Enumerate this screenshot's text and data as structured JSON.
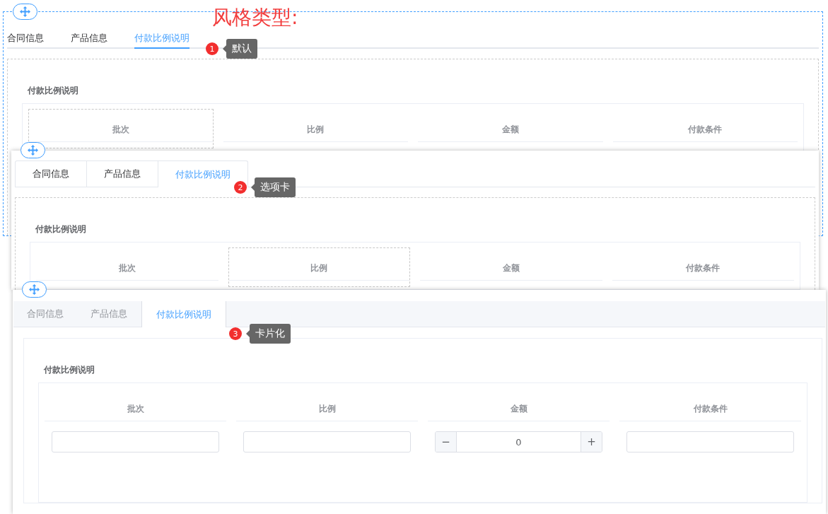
{
  "heading": "风格类型:",
  "panels": [
    {
      "kind": "default",
      "selected": true,
      "badge": "1",
      "label": "默认",
      "tabs": [
        {
          "label": "合同信息",
          "selected": false
        },
        {
          "label": "产品信息",
          "selected": false
        },
        {
          "label": "付款比例说明",
          "selected": true
        }
      ],
      "section_title": "付款比例说明",
      "columns": [
        {
          "header": "批次",
          "selected": true
        },
        {
          "header": "比例",
          "selected": false
        },
        {
          "header": "金额",
          "selected": false
        },
        {
          "header": "付款条件",
          "selected": false
        }
      ]
    },
    {
      "kind": "tabs",
      "selected": false,
      "badge": "2",
      "label": "选项卡",
      "tabs": [
        {
          "label": "合同信息",
          "selected": false
        },
        {
          "label": "产品信息",
          "selected": false
        },
        {
          "label": "付款比例说明",
          "selected": true
        }
      ],
      "section_title": "付款比例说明",
      "columns": [
        {
          "header": "批次",
          "selected": false
        },
        {
          "header": "比例",
          "selected": true
        },
        {
          "header": "金额",
          "selected": false
        },
        {
          "header": "付款条件",
          "selected": false
        }
      ]
    },
    {
      "kind": "card",
      "selected": false,
      "badge": "3",
      "label": "卡片化",
      "tabs": [
        {
          "label": "合同信息",
          "selected": false
        },
        {
          "label": "产品信息",
          "selected": false
        },
        {
          "label": "付款比例说明",
          "selected": true
        }
      ],
      "section_title": "付款比例说明",
      "columns": [
        {
          "header": "批次",
          "selected": false,
          "field": {
            "kind": "text"
          }
        },
        {
          "header": "比例",
          "selected": false,
          "field": {
            "kind": "text"
          }
        },
        {
          "header": "金额",
          "selected": false,
          "field": {
            "kind": "number",
            "value": "0",
            "minus": "−",
            "plus": "+"
          }
        },
        {
          "header": "付款条件",
          "selected": false,
          "field": {
            "kind": "text"
          }
        }
      ]
    }
  ]
}
